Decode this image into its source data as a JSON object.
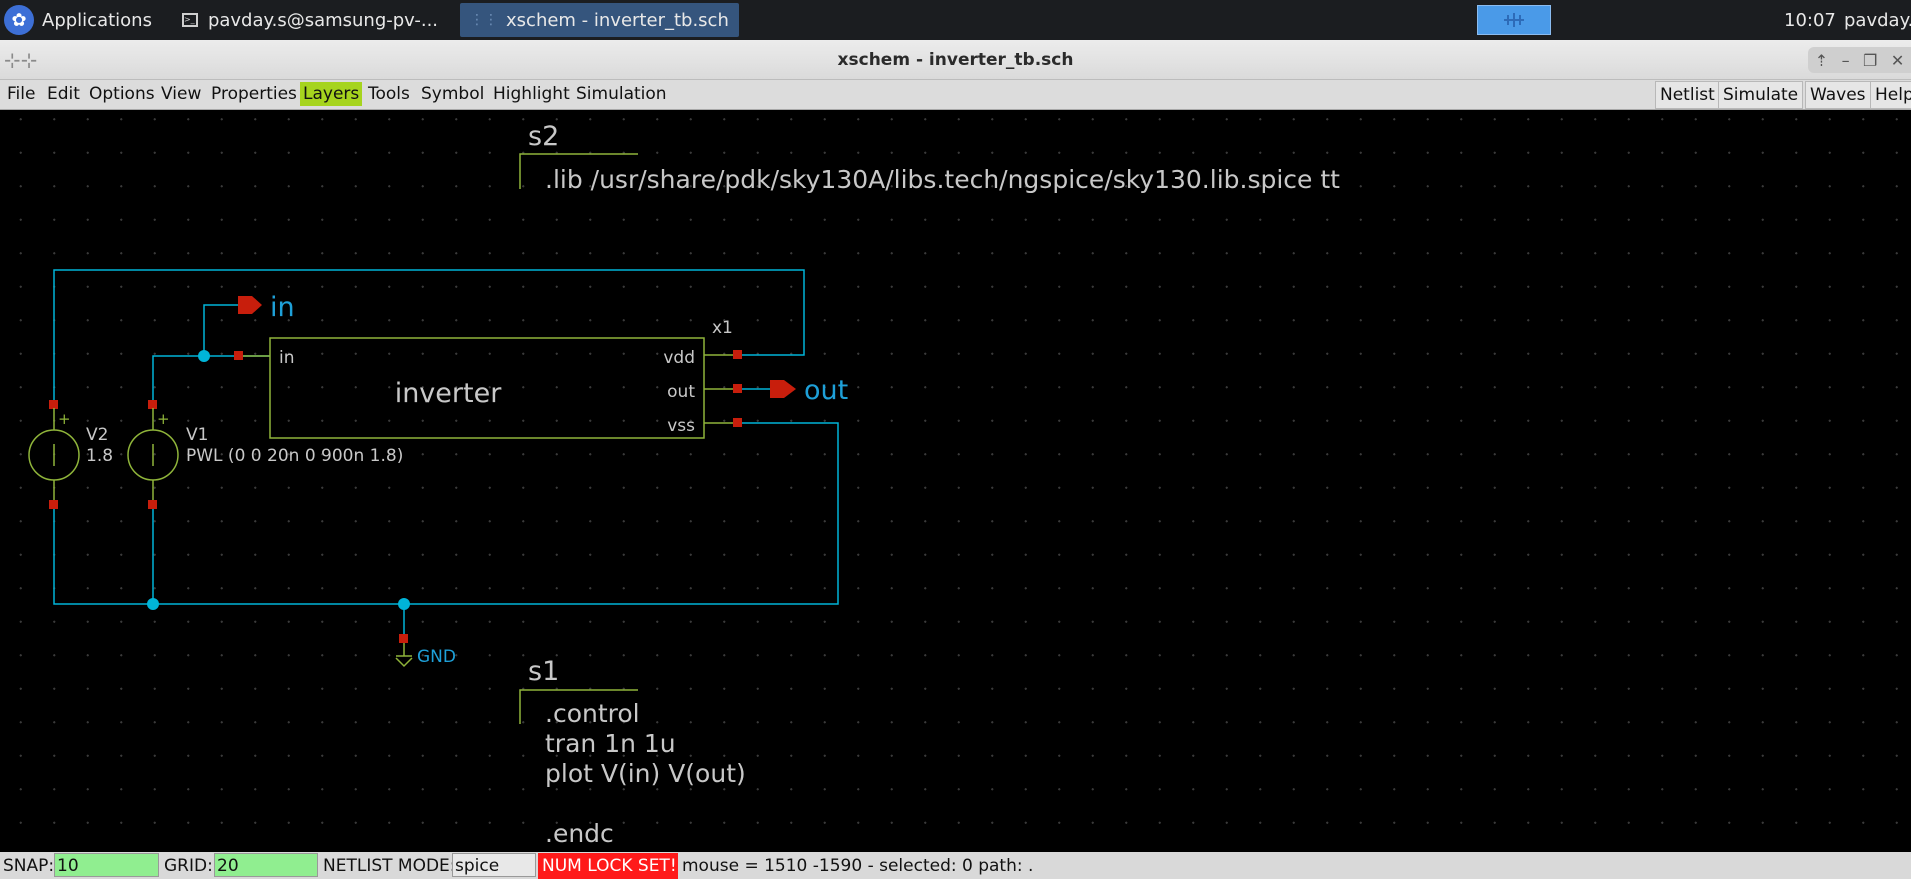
{
  "taskbar": {
    "applications_label": "Applications",
    "tasks": [
      {
        "label": "pavday.s@samsung-pv-..."
      },
      {
        "label": "xschem - inverter_tb.sch"
      }
    ],
    "clock": "10:07",
    "user": "pavday.s"
  },
  "window": {
    "title": "xschem - inverter_tb.sch"
  },
  "menubar": {
    "items": [
      "File",
      "Edit",
      "Options",
      "View",
      "Properties",
      "Layers",
      "Tools",
      "Symbol",
      "Highlight",
      "Simulation"
    ],
    "highlighted": "Layers",
    "buttons": [
      "Netlist",
      "Simulate",
      "Waves",
      "Help"
    ]
  },
  "schematic": {
    "s2_label": "s2",
    "s2_code": ".lib /usr/share/pdk/sky130A/libs.tech/ngspice/sky130.lib.spice tt",
    "in_label": "in",
    "out_label": "out",
    "gnd_label": "GND",
    "instance_name": "x1",
    "cell_name": "inverter",
    "pins": {
      "in": "in",
      "vdd": "vdd",
      "out": "out",
      "vss": "vss"
    },
    "v2": {
      "name": "V2",
      "value": "1.8"
    },
    "v1": {
      "name": "V1",
      "value": "PWL (0 0 20n 0 900n 1.8)"
    },
    "plus_sign": "+",
    "s1_label": "s1",
    "s1_code": [
      ".control",
      "tran 1n 1u",
      "plot V(in) V(out)",
      "",
      ".endc"
    ],
    "colors": {
      "wire": "#00b4d8",
      "symbol": "#8fb43a",
      "pin": "#c81e0c",
      "text": "#c8c8c8",
      "label": "#1ea0d8"
    }
  },
  "statusbar": {
    "snap_label": "SNAP:",
    "snap_value": "10",
    "grid_label": "GRID:",
    "grid_value": "20",
    "netlist_mode_label": "NETLIST MODE:",
    "netlist_mode_value": "spice",
    "numlock": "NUM LOCK SET!",
    "info": "mouse = 1510 -1590 - selected: 0 path: ."
  }
}
